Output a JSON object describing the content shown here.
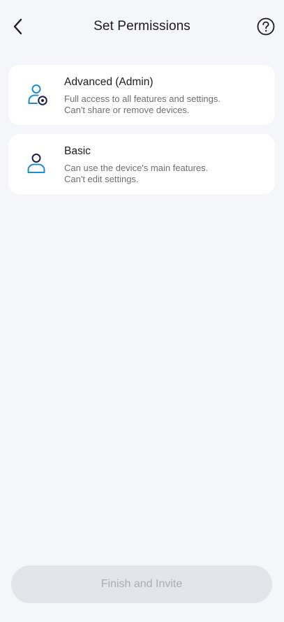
{
  "header": {
    "title": "Set Permissions",
    "back_icon": "chevron-left-icon",
    "help_icon": "help-circle-icon"
  },
  "options": [
    {
      "title": "Advanced (Admin)",
      "desc_line1": "Full access to all features and settings.",
      "desc_line2": "Can't share or remove devices.",
      "icon": "user-gear-icon"
    },
    {
      "title": "Basic",
      "desc_line1": "Can use the device's main features.",
      "desc_line2": "Can't edit settings.",
      "icon": "user-icon"
    }
  ],
  "footer": {
    "button_label": "Finish and Invite"
  },
  "colors": {
    "background": "#f5f6fa",
    "card": "#ffffff",
    "icon_dark": "#1c2142",
    "icon_accent": "#1a8fd6",
    "button_disabled_bg": "#e3e5ea",
    "button_disabled_text": "#a9adb5"
  }
}
